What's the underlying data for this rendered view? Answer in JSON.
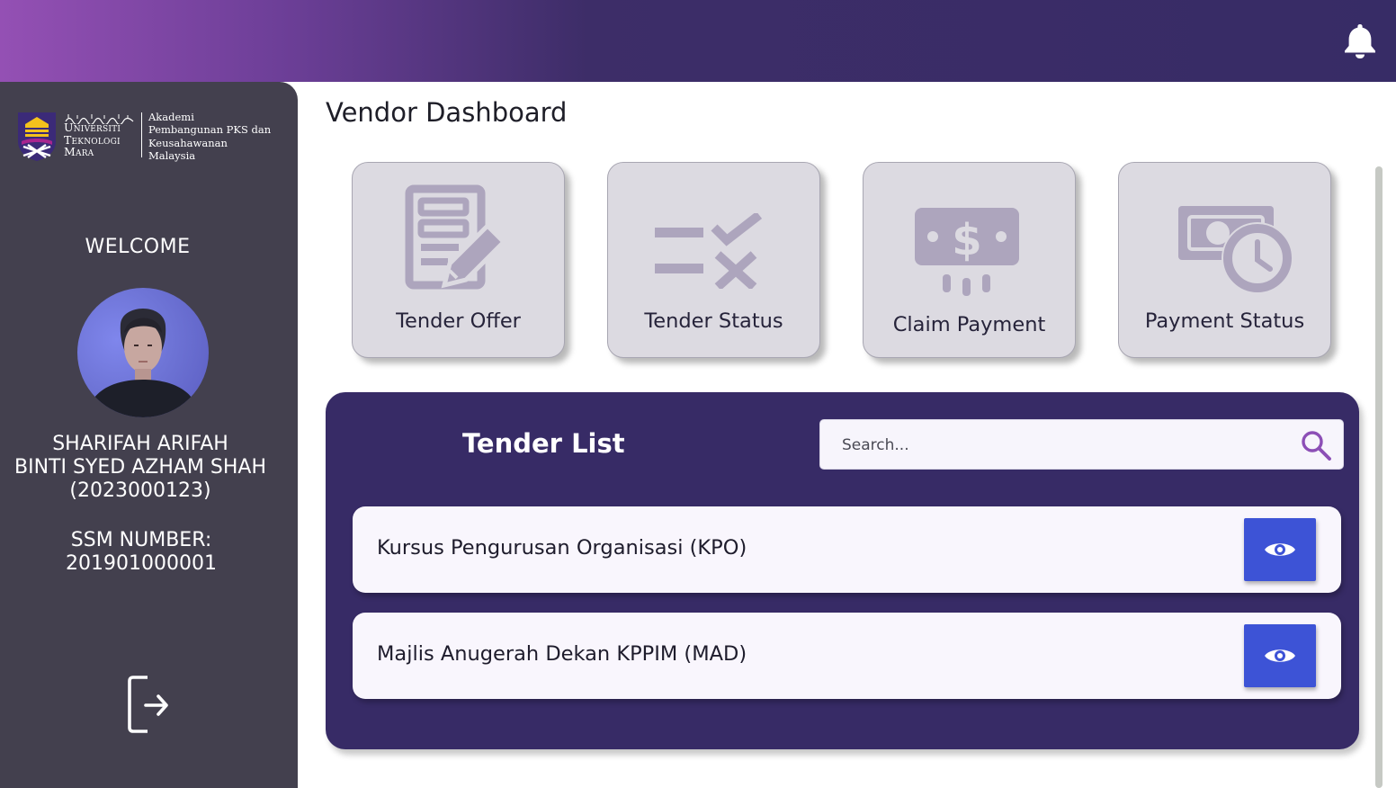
{
  "header": {
    "notification_icon": "bell-icon",
    "gradient_start": "#9450b4",
    "gradient_end": "#372c66"
  },
  "sidebar": {
    "logo": {
      "jawi_text": "يونيۏرسيتي تيكنولوڬي مارا",
      "university_lines": [
        "Universiti",
        "Teknologi",
        "Mara"
      ],
      "academy_lines": [
        "Akademi",
        "Pembangunan PKS dan",
        "Keusahawanan",
        "Malaysia"
      ]
    },
    "welcome": "WELCOME",
    "user_name_line1": "SHARIFAH ARIFAH",
    "user_name_line2": "BINTI SYED AZHAM SHAH",
    "user_id": "(2023000123)",
    "ssm_label": "SSM NUMBER:",
    "ssm_number": "201901000001",
    "logout_icon": "logout-icon",
    "background": "#43404e"
  },
  "main": {
    "page_title": "Vendor Dashboard",
    "cards": [
      {
        "label": "Tender Offer",
        "icon": "document-edit-icon"
      },
      {
        "label": "Tender Status",
        "icon": "checklist-status-icon"
      },
      {
        "label": "Claim Payment",
        "icon": "money-claim-icon"
      },
      {
        "label": "Payment Status",
        "icon": "money-clock-icon"
      }
    ],
    "tender_list": {
      "title": "Tender List",
      "search_placeholder": "Search...",
      "items": [
        {
          "name": "Kursus Pengurusan Organisasi (KPO)",
          "action_icon": "eye-icon"
        },
        {
          "name": "Majlis Anugerah Dekan KPPIM (MAD)",
          "action_icon": "eye-icon"
        }
      ],
      "panel_color": "#372b66",
      "view_button_color": "#3d53d6"
    }
  }
}
